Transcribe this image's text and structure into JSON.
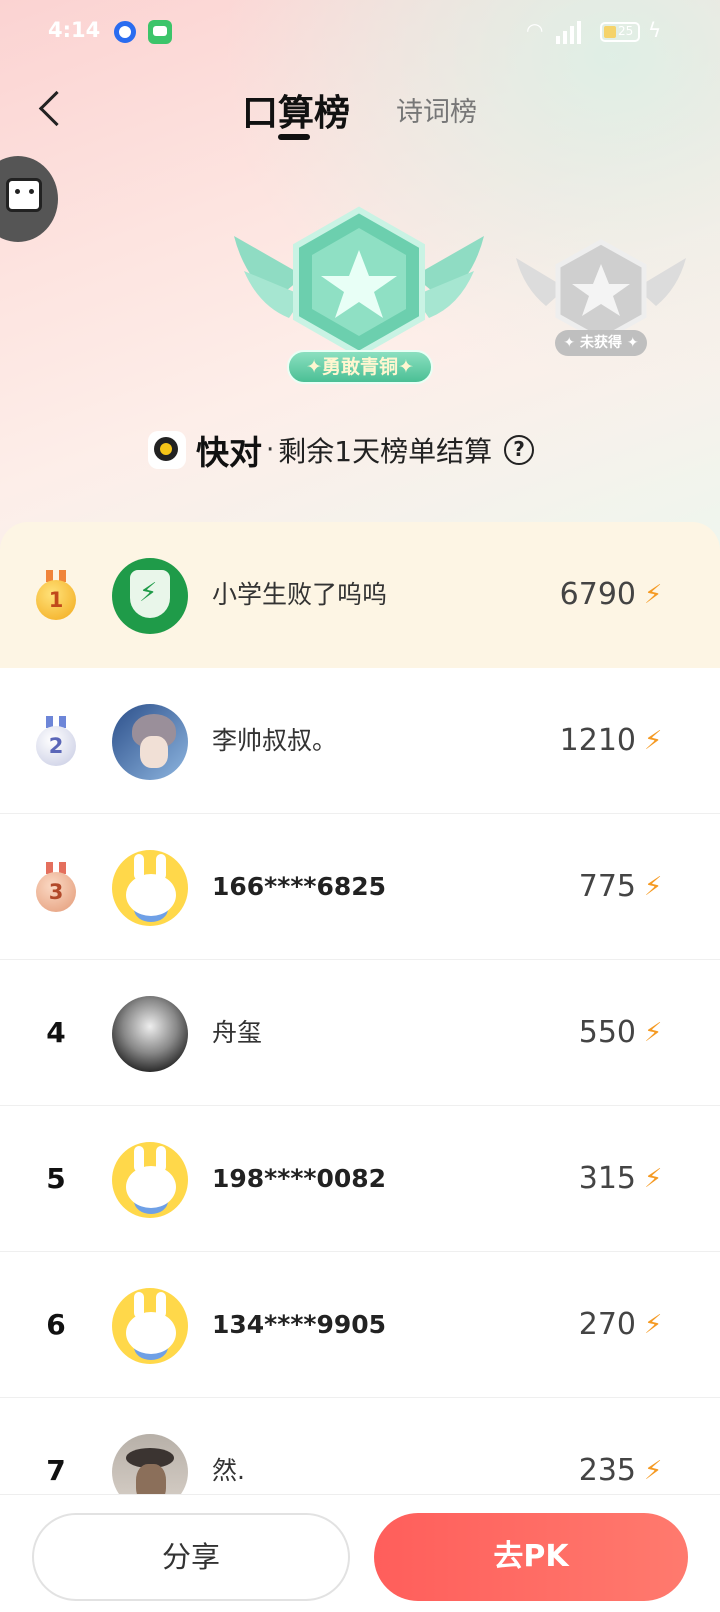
{
  "status_bar": {
    "time": "4:14",
    "battery": "25"
  },
  "header": {
    "tabs": [
      {
        "label": "口算榜",
        "active": true
      },
      {
        "label": "诗词榜",
        "active": false
      }
    ]
  },
  "badges": {
    "current": {
      "label": "✦勇敢青铜✦",
      "color": "#5fcba3"
    },
    "next": {
      "label": "✦ 未获得 ✦",
      "color": "#c4c4c4"
    }
  },
  "info": {
    "app_name": "快对",
    "separator": "·",
    "text": "剩余1天榜单结算",
    "help": "?"
  },
  "leaderboard": [
    {
      "rank": "1",
      "name": "小学生败了呜呜",
      "score": "6790",
      "medal": "gold",
      "avatar": "shield"
    },
    {
      "rank": "2",
      "name": "李帅叔叔。",
      "score": "1210",
      "medal": "silver",
      "avatar": "anime"
    },
    {
      "rank": "3",
      "name": "166****6825",
      "score": "775",
      "medal": "bronze",
      "avatar": "rabbit"
    },
    {
      "rank": "4",
      "name": "舟玺",
      "score": "550",
      "avatar": "bw"
    },
    {
      "rank": "5",
      "name": "198****0082",
      "score": "315",
      "avatar": "rabbit"
    },
    {
      "rank": "6",
      "name": "134****9905",
      "score": "270",
      "avatar": "rabbit"
    },
    {
      "rank": "7",
      "name": "然.",
      "score": "235",
      "avatar": "hat"
    }
  ],
  "footer": {
    "share_label": "分享",
    "pk_label": "去PK"
  },
  "colors": {
    "accent": "#ff6360",
    "bolt": "#f59a23",
    "first_row_bg": "#fdf5e4"
  }
}
